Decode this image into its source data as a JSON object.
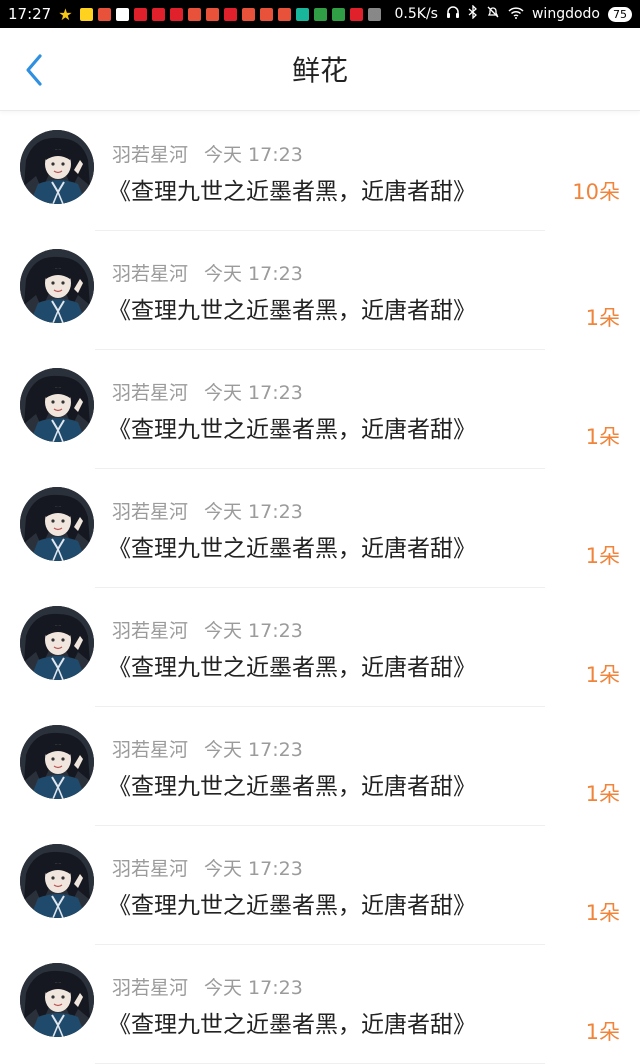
{
  "status_bar": {
    "time": "17:27",
    "net_speed": "0.5K/s",
    "wifi_name": "wingdodo",
    "battery": "75"
  },
  "header": {
    "title": "鲜花"
  },
  "list": [
    {
      "user": "羽若星河",
      "time": "今天 17:23",
      "book": "《查理九世之近墨者黑，近唐者甜》",
      "count": "10朵"
    },
    {
      "user": "羽若星河",
      "time": "今天 17:23",
      "book": "《查理九世之近墨者黑，近唐者甜》",
      "count": "1朵"
    },
    {
      "user": "羽若星河",
      "time": "今天 17:23",
      "book": "《查理九世之近墨者黑，近唐者甜》",
      "count": "1朵"
    },
    {
      "user": "羽若星河",
      "time": "今天 17:23",
      "book": "《查理九世之近墨者黑，近唐者甜》",
      "count": "1朵"
    },
    {
      "user": "羽若星河",
      "time": "今天 17:23",
      "book": "《查理九世之近墨者黑，近唐者甜》",
      "count": "1朵"
    },
    {
      "user": "羽若星河",
      "time": "今天 17:23",
      "book": "《查理九世之近墨者黑，近唐者甜》",
      "count": "1朵"
    },
    {
      "user": "羽若星河",
      "time": "今天 17:23",
      "book": "《查理九世之近墨者黑，近唐者甜》",
      "count": "1朵"
    },
    {
      "user": "羽若星河",
      "time": "今天 17:23",
      "book": "《查理九世之近墨者黑，近唐者甜》",
      "count": "1朵"
    }
  ],
  "colors": {
    "accent": "#2f8fe0",
    "count": "#f0843a",
    "meta": "#9b9b9b"
  },
  "icons": {
    "back": "chevron-left-icon",
    "avatar": "user-avatar"
  }
}
